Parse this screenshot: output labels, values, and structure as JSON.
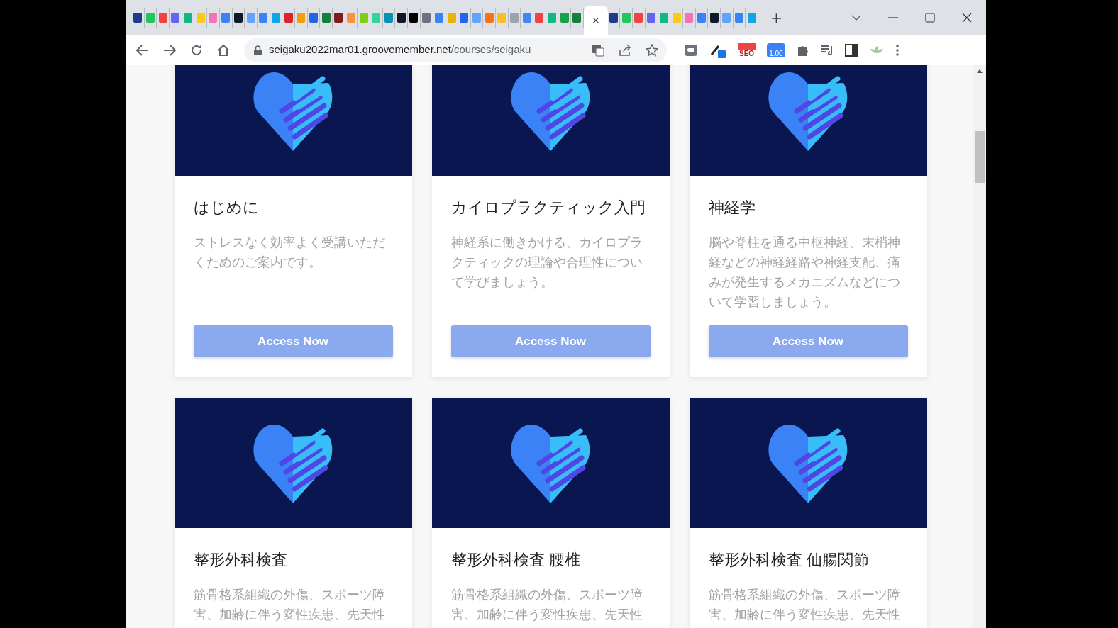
{
  "browser": {
    "tabs": [
      {
        "selected": false
      },
      {
        "selected": false
      },
      {
        "selected": false
      },
      {
        "selected": false
      },
      {
        "selected": false
      },
      {
        "selected": false
      },
      {
        "selected": false
      },
      {
        "selected": false
      },
      {
        "selected": false
      },
      {
        "selected": false
      },
      {
        "selected": false
      },
      {
        "selected": false
      },
      {
        "selected": false
      },
      {
        "selected": false
      },
      {
        "selected": false
      },
      {
        "selected": false
      },
      {
        "selected": false
      },
      {
        "selected": false
      },
      {
        "selected": false
      },
      {
        "selected": false
      },
      {
        "selected": false
      },
      {
        "selected": false
      },
      {
        "selected": false
      },
      {
        "selected": false
      },
      {
        "selected": false
      },
      {
        "selected": false
      },
      {
        "selected": false
      },
      {
        "selected": false
      },
      {
        "selected": false
      },
      {
        "selected": false
      },
      {
        "selected": false
      },
      {
        "selected": false
      },
      {
        "selected": false
      },
      {
        "selected": false
      },
      {
        "selected": false
      },
      {
        "selected": false
      },
      {
        "selected": true
      },
      {
        "selected": false
      },
      {
        "selected": false
      },
      {
        "selected": false
      },
      {
        "selected": false
      },
      {
        "selected": false
      },
      {
        "selected": false
      },
      {
        "selected": false
      },
      {
        "selected": false
      },
      {
        "selected": false
      },
      {
        "selected": false
      },
      {
        "selected": false
      },
      {
        "selected": false
      }
    ],
    "close_tab_label": "×",
    "new_tab_label": "+",
    "url_host": "seigaku2022mar01.groovemember.net",
    "url_path": "/courses/seigaku",
    "extension_badges": [
      {
        "kind": "seo",
        "text": "SEO"
      },
      {
        "kind": "speed",
        "text": "1.00"
      }
    ]
  },
  "courses": [
    {
      "title": "はじめに",
      "description": "ストレスなく効率よく受講いただくためのご案内です。",
      "button": "Access Now"
    },
    {
      "title": "カイロプラクティック入門",
      "description": "神経系に働きかける、カイロプラクティックの理論や合理性について学びましょう。",
      "button": "Access Now"
    },
    {
      "title": "神経学",
      "description": "脳や脊柱を通る中枢神経、末梢神経などの神経経路や神経支配、痛みが発生するメカニズムなどについて学習しましょう。",
      "button": "Access Now"
    },
    {
      "title": "整形外科検査",
      "description": "筋骨格系組織の外傷、スポーツ障害、加齢に伴う変性疾患、先天性"
    },
    {
      "title": "整形外科検査 腰椎",
      "description": "筋骨格系組織の外傷、スポーツ障害、加齢に伴う変性疾患、先天性"
    },
    {
      "title": "整形外科検査 仙腸関節",
      "description": "筋骨格系組織の外傷、スポーツ障害、加齢に伴う変性疾患、先天性"
    }
  ]
}
